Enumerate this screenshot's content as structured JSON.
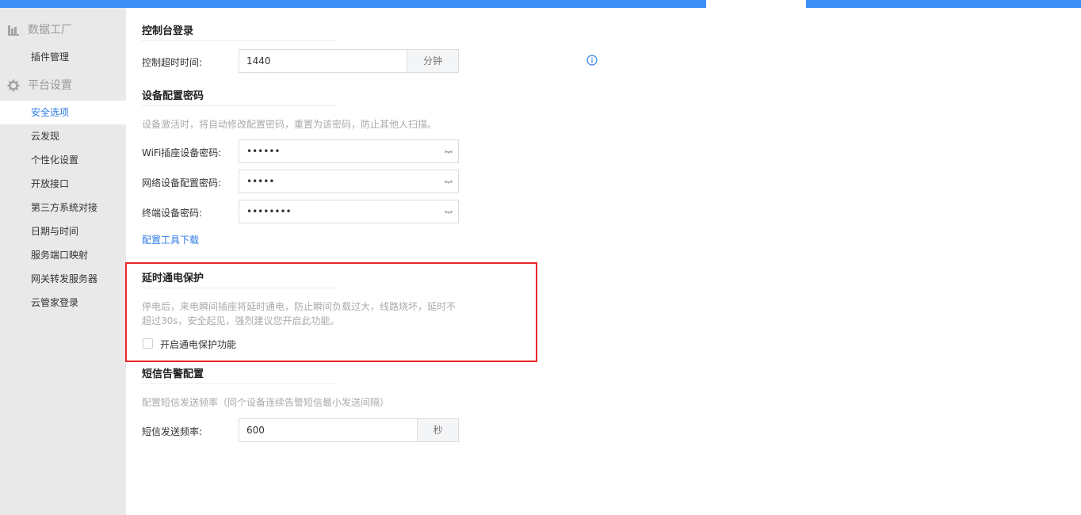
{
  "sidebar": {
    "groups": [
      {
        "icon": "bar-chart-icon",
        "label": "数据工厂"
      },
      {
        "icon": "gear-icon",
        "label": "平台设置"
      }
    ],
    "data_factory_items": [
      "插件管理"
    ],
    "platform_items": [
      "安全选项",
      "云发现",
      "个性化设置",
      "开放接口",
      "第三方系统对接",
      "日期与时间",
      "服务端口映射",
      "网关转发服务器",
      "云管家登录"
    ],
    "active_item": "安全选项"
  },
  "console_login": {
    "title": "控制台登录",
    "timeout_label": "控制超时时间:",
    "timeout_value": "1440",
    "timeout_unit": "分钟"
  },
  "device_password": {
    "title": "设备配置密码",
    "description": "设备激活时，将自动修改配置密码，重置为该密码，防止其他人扫描。",
    "wifi_label": "WiFi插座设备密码:",
    "wifi_value": "••••••",
    "network_label": "网络设备配置密码:",
    "network_value": "•••••",
    "terminal_label": "终端设备密码:",
    "terminal_value": "••••••••",
    "tool_download": "配置工具下载"
  },
  "power_protection": {
    "title": "延时通电保护",
    "description_line1": "停电后，来电瞬间插座将延时通电，防止瞬间负载过大，线路烧坏，延时不",
    "description_line2": "超过30s，安全起见，强烈建议您开启此功能。",
    "checkbox_label": "开启通电保护功能"
  },
  "sms_alert": {
    "title": "短信告警配置",
    "description": "配置短信发送频率（同个设备连续告警短信最小发送间隔）",
    "freq_label": "短信发送频率:",
    "freq_value": "600",
    "freq_unit": "秒"
  },
  "colors": {
    "accent": "#3d8ef5",
    "link": "#2d7be5",
    "highlight_border": "#e8262a",
    "sidebar_bg": "#e9e9e9"
  }
}
